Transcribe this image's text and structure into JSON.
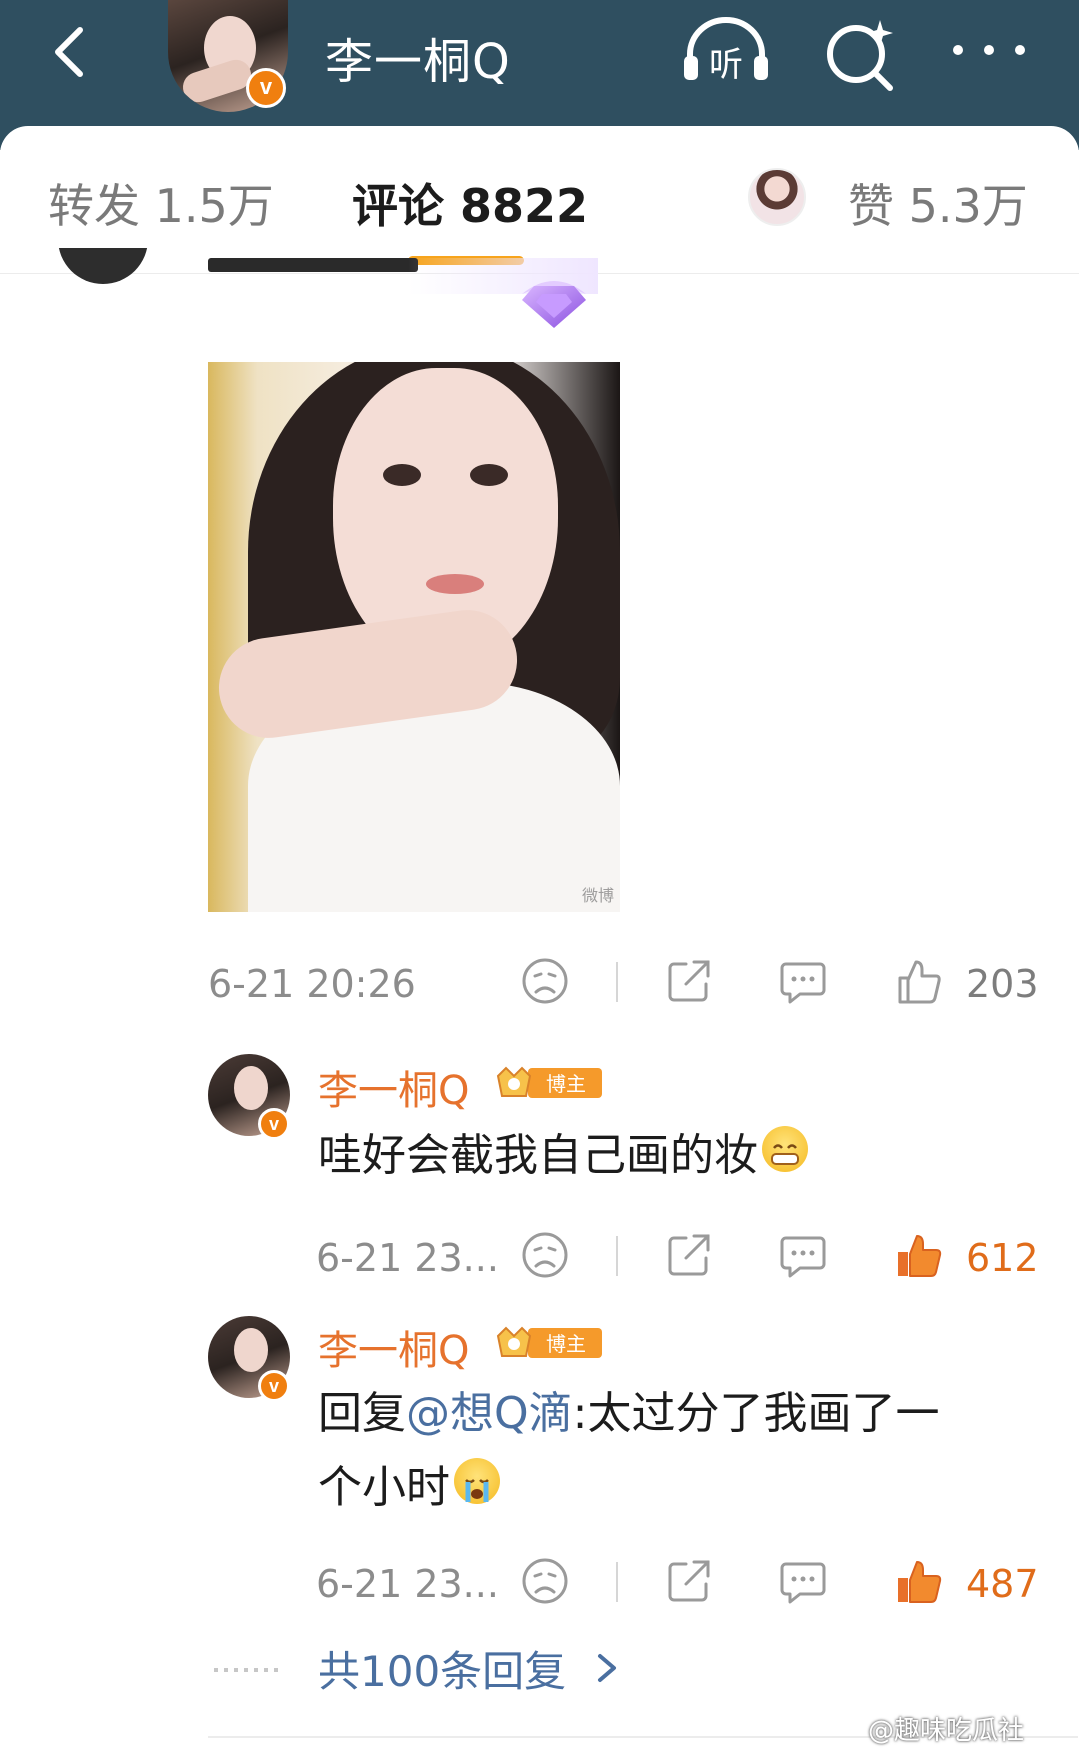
{
  "header": {
    "title": "李一桐Q",
    "verified_glyph": "v",
    "listen_label": "听"
  },
  "tabs": [
    {
      "label": "转发 1.5万"
    },
    {
      "label": "评论 8822"
    },
    {
      "label": "赞 5.3万"
    }
  ],
  "post": {
    "time": "6-21 20:26",
    "like_count": "203",
    "photo_watermark": "微博"
  },
  "replies": [
    {
      "author": "李一桐Q",
      "badge_label": "博主",
      "text": "哇好会截我自己画的妆",
      "time": "6-21 23...",
      "like_count": "612"
    },
    {
      "author": "李一桐Q",
      "badge_label": "博主",
      "text_prefix": "回复",
      "mention": "@想Q滴",
      "text_line1_rest": ":太过分了我画了一",
      "text_line2": "个小时",
      "time": "6-21 23...",
      "like_count": "487"
    }
  ],
  "more_replies": {
    "label": "共100条回复"
  },
  "watermark": "@趣味吃瓜社",
  "colors": {
    "header_bg": "#2f4f60",
    "accent_orange": "#e6722d",
    "tab_indicator": "#f7a41c",
    "link_blue": "#4a6fa0"
  }
}
